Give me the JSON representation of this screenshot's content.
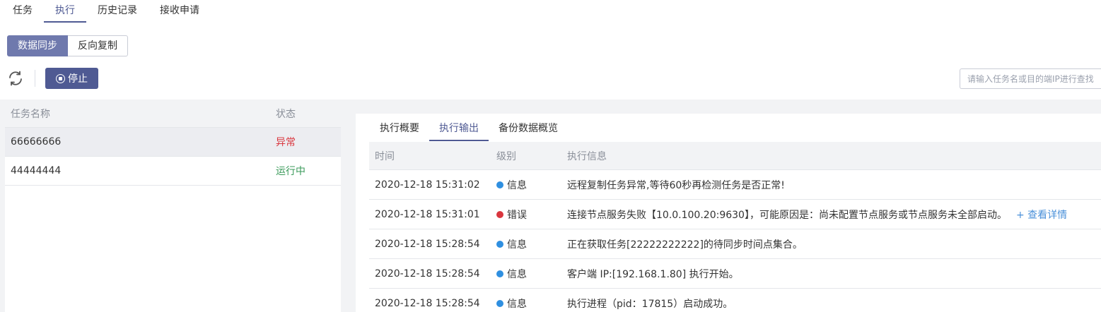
{
  "top_tabs": [
    "任务",
    "执行",
    "历史记录",
    "接收申请"
  ],
  "segments": [
    "数据同步",
    "反向复制"
  ],
  "toolbar": {
    "stop_label": "停止",
    "search_placeholder": "请输入任务名或目的端IP进行查找"
  },
  "task_table": {
    "headers": [
      "任务名称",
      "状态"
    ],
    "rows": [
      {
        "name": "66666666",
        "status": "异常"
      },
      {
        "name": "44444444",
        "status": "运行中"
      }
    ]
  },
  "detail": {
    "tabs": [
      "执行概要",
      "执行输出",
      "备份数据概览"
    ],
    "headers": [
      "时间",
      "级别",
      "执行信息"
    ],
    "rows": [
      {
        "time": "2020-12-18 15:31:02",
        "level": "信息",
        "msg": "远程复制任务异常,等待60秒再检测任务是否正常!",
        "action": ""
      },
      {
        "time": "2020-12-18 15:31:01",
        "level": "错误",
        "msg": "连接节点服务失败【10.0.100.20:9630】，可能原因是：尚未配置节点服务或节点服务未全部启动。",
        "action": "+ 查看详情"
      },
      {
        "time": "2020-12-18 15:28:54",
        "level": "信息",
        "msg": "正在获取任务[22222222222]的待同步时间点集合。",
        "action": ""
      },
      {
        "time": "2020-12-18 15:28:54",
        "level": "信息",
        "msg": "客户端 IP:[192.168.1.80] 执行开始。",
        "action": ""
      },
      {
        "time": "2020-12-18 15:28:54",
        "level": "信息",
        "msg": "执行进程（pid：17815）启动成功。",
        "action": ""
      }
    ]
  },
  "colors": {
    "primary": "#4f5a93",
    "error": "#d9363e",
    "running": "#3a9a5a",
    "info_dot": "#2f8fe0",
    "link": "#4a90d9"
  }
}
